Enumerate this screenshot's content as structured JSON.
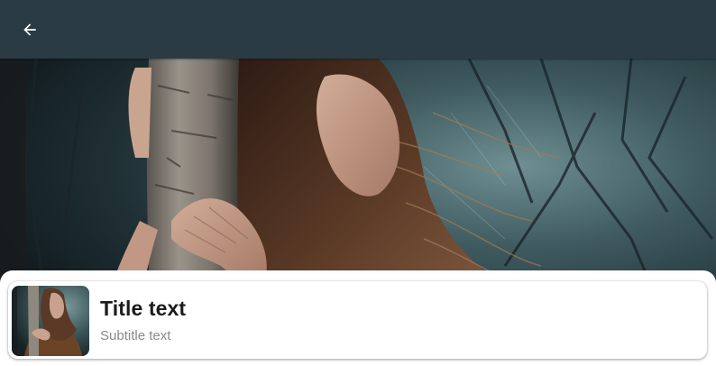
{
  "appbar": {
    "back_icon": "arrow-back-icon",
    "background": "#2a3b43",
    "icon_color": "#ffffff"
  },
  "hero": {
    "image": "photo of a woman with windswept brown hair embracing a birch tree trunk in a dark teal forest"
  },
  "card": {
    "thumbnail": "small version of the same photo",
    "title": "Title text",
    "subtitle": "Subtitle text"
  }
}
